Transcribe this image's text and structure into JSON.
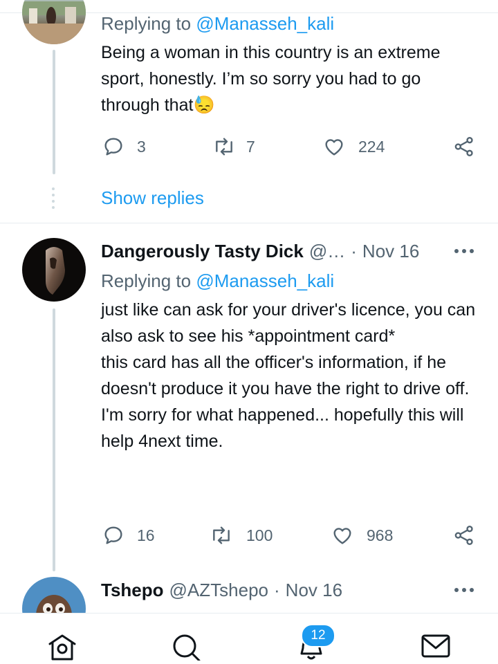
{
  "tweet1": {
    "reply_prefix": "Replying to",
    "reply_handle": "@Manasseh_kali",
    "text": "Being a woman in this country is an extreme sport, honestly. I’m so sorry you had to go through that",
    "emoji": "😓",
    "replies": "3",
    "retweets": "7",
    "likes": "224"
  },
  "show_replies": "Show replies",
  "tweet2": {
    "name": "Dangerously Tasty Dick",
    "handle": "@…",
    "separator": "·",
    "date": "Nov 16",
    "reply_prefix": "Replying to",
    "reply_handle": "@Manasseh_kali",
    "lines": [
      "just like can ask for your driver's licence, you can also ask to see his *appointment card*",
      "this card has all the officer's information, if he doesn't produce it you have the right to drive off.",
      "I'm sorry for what happened... hopefully this will help 4next time."
    ],
    "replies": "16",
    "retweets": "100",
    "likes": "968"
  },
  "tweet3": {
    "name": "Tshepo",
    "handle": "@AZTshepo",
    "separator": "·",
    "date": "Nov 16"
  },
  "nav": {
    "notifications_badge": "12",
    "items": [
      "home-icon",
      "search-icon",
      "bell-icon",
      "mail-icon"
    ]
  },
  "colors": {
    "accent": "#1d9bf0",
    "muted": "#536471",
    "text": "#0f1419"
  }
}
